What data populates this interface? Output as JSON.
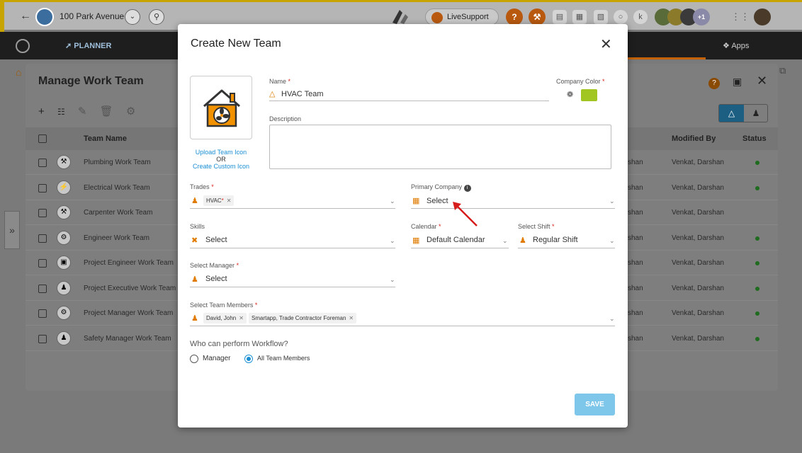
{
  "topbar": {
    "project_name": "100 Park Avenue",
    "live_support": "LiveSupport",
    "help_icon": "?",
    "user_badge": "+1"
  },
  "navbar": {
    "planner": "PLANNER",
    "apps": "Apps"
  },
  "panel": {
    "title": "Manage Work Team",
    "columns": {
      "team_name": "Team Name",
      "modified_by": "Modified By",
      "status": "Status"
    },
    "rows": [
      {
        "name": "Plumbing Work Team",
        "created": "shan",
        "modified": "Venkat, Darshan",
        "active": true
      },
      {
        "name": "Electrical Work Team",
        "created": "shan",
        "modified": "Venkat, Darshan",
        "active": true
      },
      {
        "name": "Carpenter Work Team",
        "created": "shan",
        "modified": "Venkat, Darshan",
        "active": false
      },
      {
        "name": "Engineer Work Team",
        "created": "shan",
        "modified": "Venkat, Darshan",
        "active": true
      },
      {
        "name": "Project Engineer Work Team",
        "created": "shan",
        "modified": "Venkat, Darshan",
        "active": true
      },
      {
        "name": "Project Executive Work Team",
        "created": "shan",
        "modified": "Venkat, Darshan",
        "active": true
      },
      {
        "name": "Project Manager Work Team",
        "created": "shan",
        "modified": "Venkat, Darshan",
        "active": true
      },
      {
        "name": "Safety Manager Work Team",
        "created": "shan",
        "modified": "Venkat, Darshan",
        "active": true
      }
    ]
  },
  "modal": {
    "title": "Create New Team",
    "upload_icon": "Upload Team Icon",
    "or": "OR",
    "custom_icon": "Create Custom Icon",
    "name_label": "Name",
    "name_value": "HVAC Team",
    "company_color_label": "Company Color",
    "company_color": "#a2c621",
    "description_label": "Description",
    "trades_label": "Trades",
    "trades_chip": "HVAC",
    "primary_company_label": "Primary Company",
    "primary_company_value": "Select",
    "skills_label": "Skills",
    "skills_value": "Select",
    "calendar_label": "Calendar",
    "calendar_value": "Default Calendar",
    "shift_label": "Select Shift",
    "shift_value": "Regular Shift",
    "manager_label": "Select Manager",
    "manager_value": "Select",
    "members_label": "Select Team Members",
    "members": [
      "David, John",
      "Smartapp, Trade Contractor Foreman"
    ],
    "workflow_label": "Who can perform Workflow?",
    "workflow_options": [
      "Manager",
      "All Team Members"
    ],
    "workflow_selected": "All Team Members",
    "save": "SAVE"
  }
}
